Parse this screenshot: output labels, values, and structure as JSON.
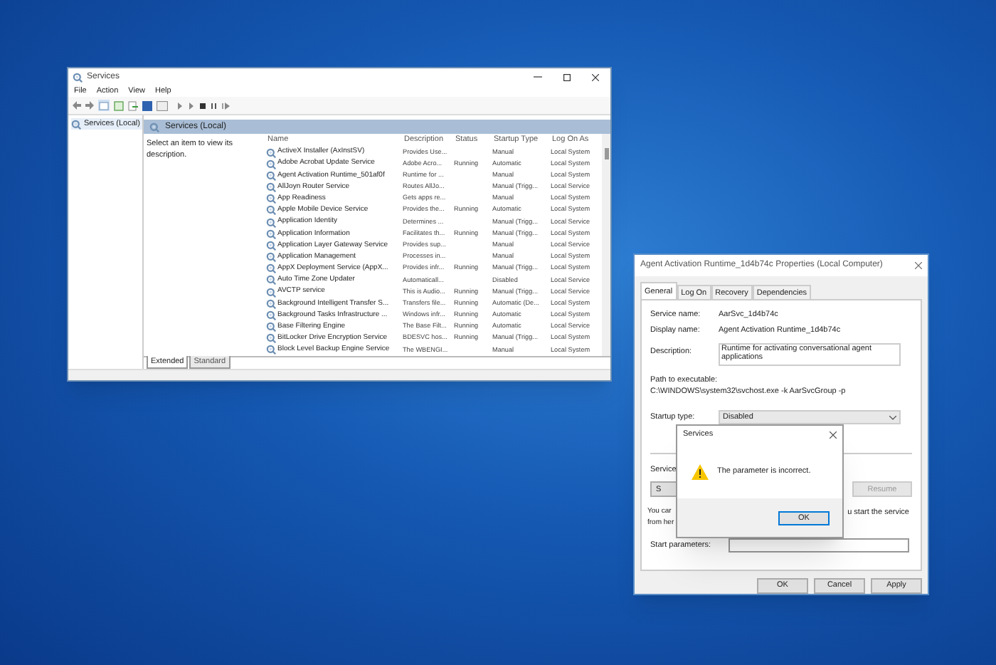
{
  "services_window": {
    "title": "Services",
    "menu": [
      "File",
      "Action",
      "View",
      "Help"
    ],
    "tree_item": "Services (Local)",
    "panel_header": "Services (Local)",
    "description_hint": "Select an item to view its description.",
    "columns": [
      "Name",
      "Description",
      "Status",
      "Startup Type",
      "Log On As"
    ],
    "rows": [
      [
        "ActiveX Installer (AxInstSV)",
        "Provides Use...",
        "",
        "Manual",
        "Local System"
      ],
      [
        "Adobe Acrobat Update Service",
        "Adobe Acro...",
        "Running",
        "Automatic",
        "Local System"
      ],
      [
        "Agent Activation Runtime_501af0f",
        "Runtime for ...",
        "",
        "Manual",
        "Local System"
      ],
      [
        "AllJoyn Router Service",
        "Routes AllJo...",
        "",
        "Manual (Trigg...",
        "Local Service"
      ],
      [
        "App Readiness",
        "Gets apps re...",
        "",
        "Manual",
        "Local System"
      ],
      [
        "Apple Mobile Device Service",
        "Provides the...",
        "Running",
        "Automatic",
        "Local System"
      ],
      [
        "Application Identity",
        "Determines ...",
        "",
        "Manual (Trigg...",
        "Local Service"
      ],
      [
        "Application Information",
        "Facilitates th...",
        "Running",
        "Manual (Trigg...",
        "Local System"
      ],
      [
        "Application Layer Gateway Service",
        "Provides sup...",
        "",
        "Manual",
        "Local Service"
      ],
      [
        "Application Management",
        "Processes in...",
        "",
        "Manual",
        "Local System"
      ],
      [
        "AppX Deployment Service (AppX...",
        "Provides infr...",
        "Running",
        "Manual (Trigg...",
        "Local System"
      ],
      [
        "Auto Time Zone Updater",
        "Automaticall...",
        "",
        "Disabled",
        "Local Service"
      ],
      [
        "AVCTP service",
        "This is Audio...",
        "Running",
        "Manual (Trigg...",
        "Local Service"
      ],
      [
        "Background Intelligent Transfer S...",
        "Transfers file...",
        "Running",
        "Automatic (De...",
        "Local System"
      ],
      [
        "Background Tasks Infrastructure ...",
        "Windows infr...",
        "Running",
        "Automatic",
        "Local System"
      ],
      [
        "Base Filtering Engine",
        "The Base Filt...",
        "Running",
        "Automatic",
        "Local Service"
      ],
      [
        "BitLocker Drive Encryption Service",
        "BDESVC hos...",
        "Running",
        "Manual (Trigg...",
        "Local System"
      ],
      [
        "Block Level Backup Engine Service",
        "The WBENGI...",
        "",
        "Manual",
        "Local System"
      ]
    ],
    "tabs": [
      {
        "label": "Extended",
        "selected": true
      },
      {
        "label": "Standard",
        "selected": false
      }
    ]
  },
  "properties_dialog": {
    "title": "Agent Activation Runtime_1d4b74c Properties (Local Computer)",
    "tabs": [
      {
        "label": "General",
        "selected": true
      },
      {
        "label": "Log On",
        "selected": false
      },
      {
        "label": "Recovery",
        "selected": false
      },
      {
        "label": "Dependencies",
        "selected": false
      }
    ],
    "service_name": {
      "label": "Service name:",
      "value": "AarSvc_1d4b74c"
    },
    "display_name": {
      "label": "Display name:",
      "value": "Agent Activation Runtime_1d4b74c"
    },
    "description": {
      "label": "Description:",
      "value": "Runtime for activating conversational agent applications"
    },
    "path": {
      "label": "Path to executable:",
      "value": "C:\\WINDOWS\\system32\\svchost.exe -k AarSvcGroup -p"
    },
    "startup_type": {
      "label": "Startup type:",
      "value": "Disabled"
    },
    "service_status_label": "Service",
    "control_buttons": [
      {
        "label": "S",
        "disabled": false
      },
      {
        "label": "Resume",
        "disabled": true
      }
    ],
    "note_left": [
      "You car",
      "from her"
    ],
    "note_right": "u start the service",
    "start_parameters": {
      "label": "Start parameters:"
    },
    "buttons": [
      "OK",
      "Cancel",
      "Apply"
    ]
  },
  "message_box": {
    "title": "Services",
    "message": "The parameter is incorrect.",
    "button": "OK"
  }
}
